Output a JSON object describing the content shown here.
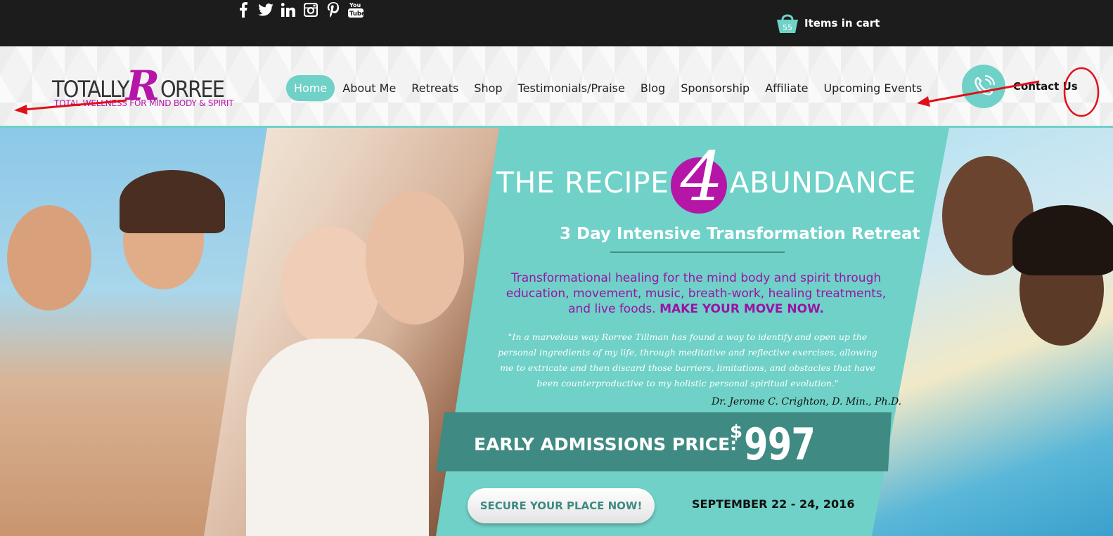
{
  "topbar": {
    "social_icons": [
      "facebook-icon",
      "twitter-icon",
      "linkedin-icon",
      "instagram-icon",
      "pinterest-icon",
      "youtube-icon"
    ],
    "youtube_glyph": "You\nTube",
    "cart": {
      "count": "55",
      "label": "Items in cart"
    }
  },
  "header": {
    "logo": {
      "part1": "TOTALLY",
      "part2": "R",
      "part3": "ORREE",
      "tagline": "TOTAL WELLNESS FOR MIND BODY & SPIRIT"
    },
    "nav": [
      {
        "label": "Home",
        "active": true
      },
      {
        "label": "About Me"
      },
      {
        "label": "Retreats"
      },
      {
        "label": "Shop"
      },
      {
        "label": "Testimonials/Praise"
      },
      {
        "label": "Blog"
      },
      {
        "label": "Sponsorship"
      },
      {
        "label": "Affiliate"
      },
      {
        "label": "Upcoming Events"
      }
    ],
    "contact_label": "Contact Us"
  },
  "hero": {
    "title_left": "THE RECIPE",
    "title_number": "4",
    "title_right": "ABUNDANCE",
    "subtitle": "3 Day Intensive Transformation Retreat",
    "blurb": "Transformational healing for the mind body and spirit through education, movement, music, breath-work, healing treatments, and live foods.",
    "blurb_cta": "MAKE YOUR MOVE NOW.",
    "quote": "\"In a marvelous way Rorree Tillman has found a way to identify and open up the personal ingredients of my life, through meditative and reflective exercises, allowing me to extricate and then discard those barriers, limitations, and obstacles that have been counterproductive to my holistic personal spiritual evolution.\"",
    "quote_author": "Dr. Jerome C. Crighton, D. Min., Ph.D.",
    "price_label": "EARLY ADMISSIONS PRICE:",
    "price_symbol": "$",
    "price_value": "997",
    "cta_label": "SECURE YOUR PLACE NOW!",
    "event_date": "SEPTEMBER 22 - 24, 2016"
  },
  "colors": {
    "accent": "#6fd1c7",
    "brand": "#b516a8",
    "dark_teal": "#3f8a82",
    "topbar": "#1c1c1c",
    "annotation": "#e0101a"
  }
}
